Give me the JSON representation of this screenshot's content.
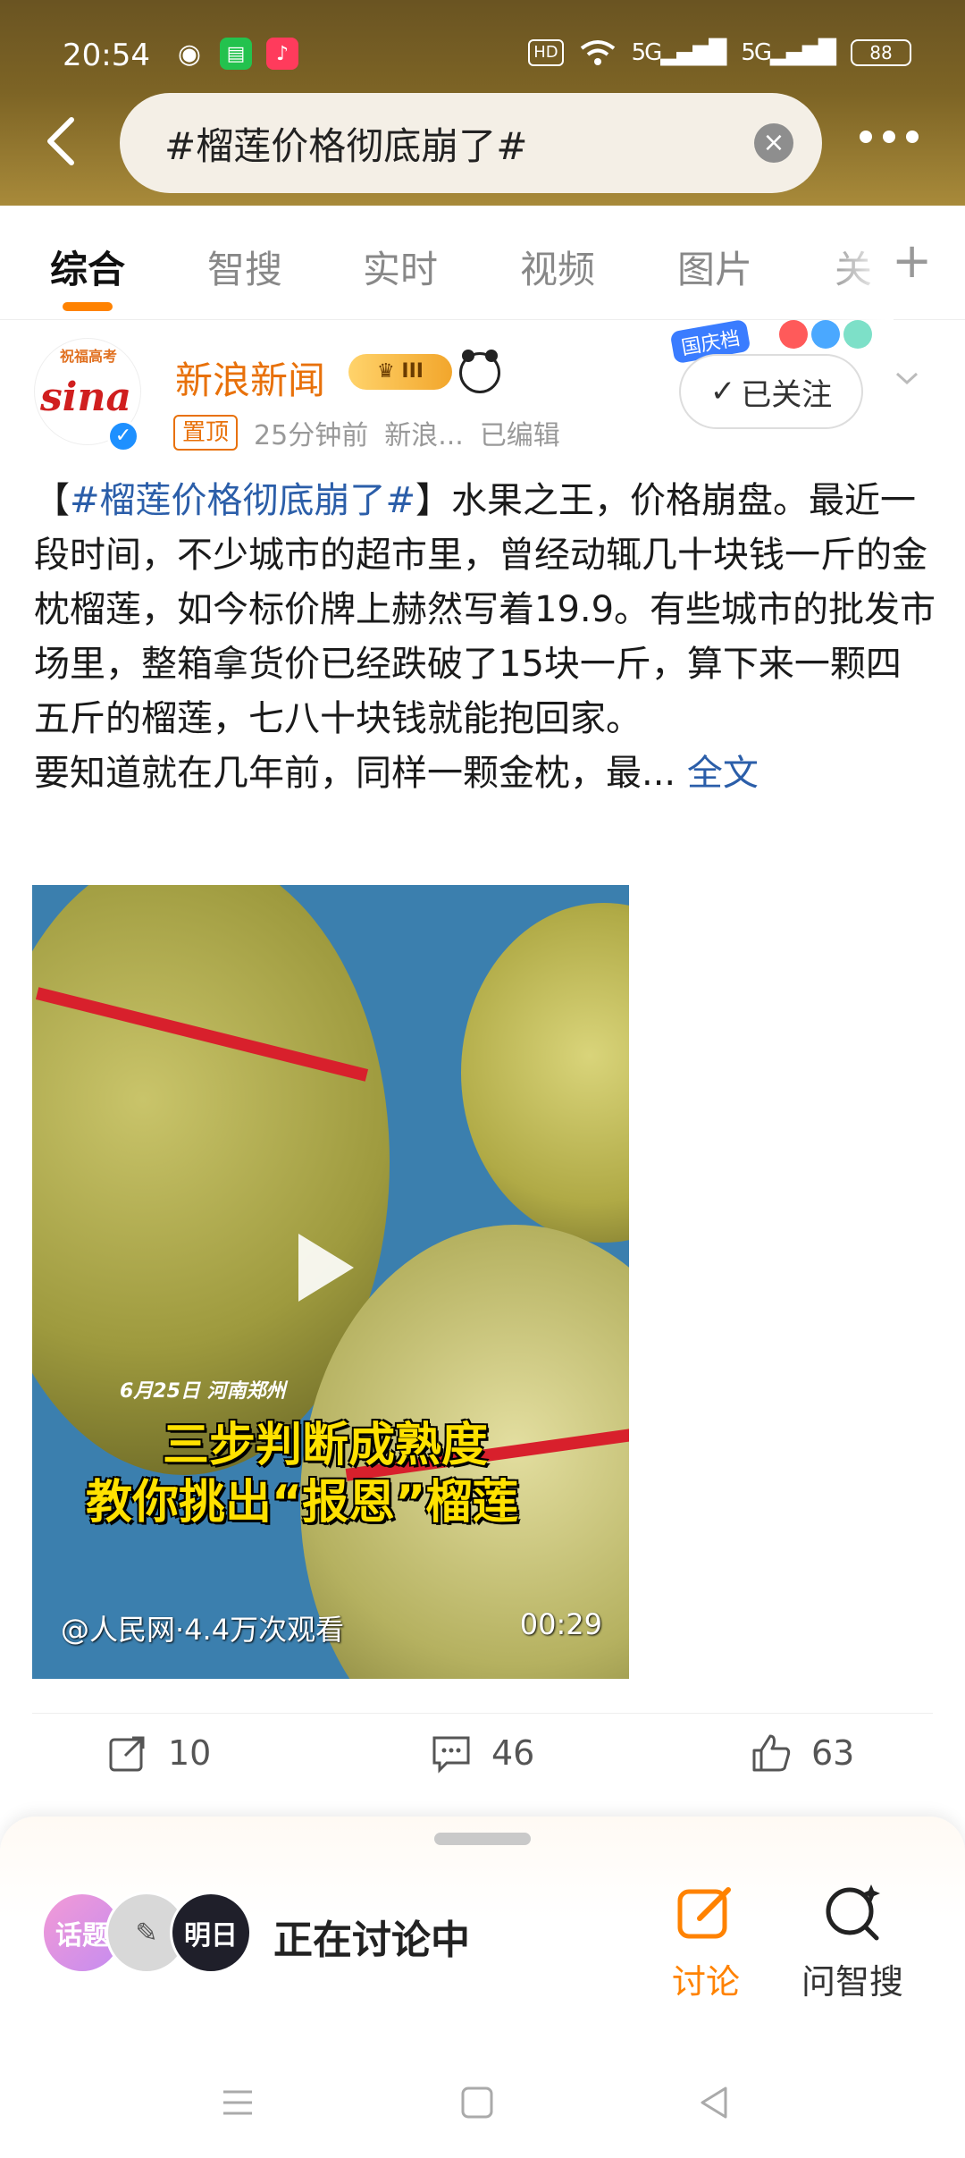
{
  "status_bar": {
    "time": "20:54",
    "hd": "HD",
    "signal1": "5G",
    "signal2": "5G",
    "battery": "88"
  },
  "search": {
    "query": "#榴莲价格彻底崩了#"
  },
  "tabs": [
    {
      "label": "综合",
      "active": true
    },
    {
      "label": "智搜"
    },
    {
      "label": "实时"
    },
    {
      "label": "视频"
    },
    {
      "label": "图片"
    },
    {
      "label": "关"
    }
  ],
  "post": {
    "avatar_top_text": "祝福高考",
    "avatar_logo": "sina",
    "author": "新浪新闻",
    "badge": "III",
    "pin_label": "置顶",
    "time": "25分钟前",
    "source": "新浪...",
    "edited": "已编辑",
    "follow_label": "已关注",
    "deco_tag": "国庆档",
    "text_hashtag": "#榴莲价格彻底崩了#",
    "text_open": "【",
    "text_close": "】",
    "text_body": "水果之王，价格崩盘。最近一段时间，不少城市的超市里，曾经动辄几十块钱一斤的金枕榴莲，如今标价牌上赫然写着19.9。有些城市的批发市场里，整箱拿货价已经跌破了15块一斤，算下来一颗四五斤的榴莲，七八十块钱就能抱回家。",
    "text_more": "要知道就在几年前，同样一颗金枕，最...",
    "full_text": "全文",
    "video": {
      "date_caption": "6月25日 河南郑州",
      "caption_line1": "三步判断成熟度",
      "caption_line2": "教你挑出“报恩”榴莲",
      "source": "@人民网·4.4万次观看",
      "duration": "00:29"
    },
    "actions": {
      "reposts": "10",
      "comments": "46",
      "likes": "63"
    }
  },
  "sheet": {
    "avatar1_text": "话题",
    "avatar3_text": "明日",
    "label": "正在讨论中",
    "discuss_label": "讨论",
    "ask_label": "问智搜"
  },
  "colors": {
    "accent": "#ff8200",
    "link": "#2b5ea9",
    "author": "#e8710a"
  }
}
